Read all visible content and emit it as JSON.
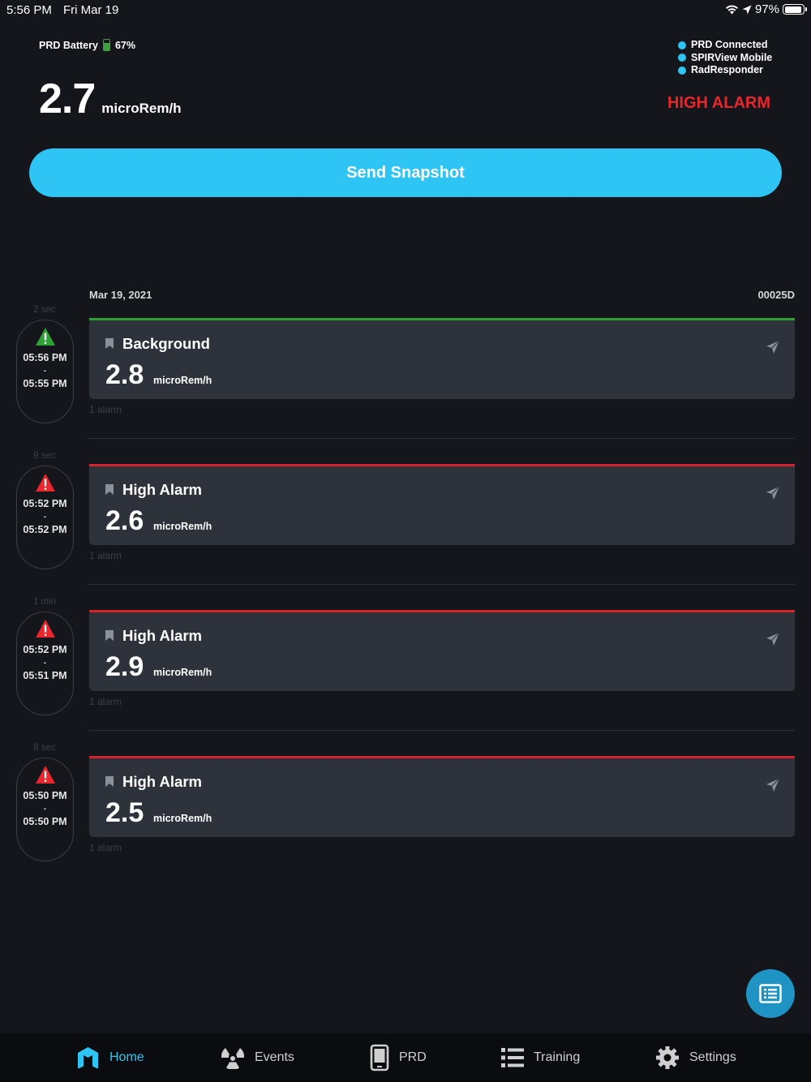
{
  "status_bar": {
    "time": "5:56 PM",
    "date": "Fri Mar 19",
    "battery": "97%"
  },
  "header": {
    "prd_battery_label": "PRD Battery",
    "prd_battery_value": "67%",
    "reading_value": "2.7",
    "reading_unit": "microRem/h",
    "connections": [
      "PRD Connected",
      "SPIRView Mobile",
      "RadResponder"
    ],
    "alarm_status": "HIGH ALARM"
  },
  "snapshot_button": "Send Snapshot",
  "list": {
    "date": "Mar 19, 2021",
    "device_id": "00025D",
    "events": [
      {
        "duration": "2 sec",
        "severity": "green",
        "start": "05:56 PM",
        "dash": "-",
        "end": "05:55 PM",
        "title": "Background",
        "value": "2.8",
        "unit": "microRem/h",
        "alarm_count": "1 alarm"
      },
      {
        "duration": "9 sec",
        "severity": "red",
        "start": "05:52 PM",
        "dash": "-",
        "end": "05:52 PM",
        "title": "High Alarm",
        "value": "2.6",
        "unit": "microRem/h",
        "alarm_count": "1 alarm"
      },
      {
        "duration": "1 min",
        "severity": "red",
        "start": "05:52 PM",
        "dash": "-",
        "end": "05:51 PM",
        "title": "High Alarm",
        "value": "2.9",
        "unit": "microRem/h",
        "alarm_count": "1 alarm"
      },
      {
        "duration": "8 sec",
        "severity": "red",
        "start": "05:50 PM",
        "dash": "-",
        "end": "05:50 PM",
        "title": "High Alarm",
        "value": "2.5",
        "unit": "microRem/h",
        "alarm_count": "1 alarm"
      }
    ]
  },
  "tabs": [
    {
      "label": "Home",
      "icon": "home-icon",
      "active": true
    },
    {
      "label": "Events",
      "icon": "radiation-icon",
      "active": false
    },
    {
      "label": "PRD",
      "icon": "device-icon",
      "active": false
    },
    {
      "label": "Training",
      "icon": "list-icon",
      "active": false
    },
    {
      "label": "Settings",
      "icon": "gear-icon",
      "active": false
    }
  ],
  "colors": {
    "accent": "#2ec4f4",
    "alarm": "#e8262b",
    "ok": "#2fa236",
    "background": "#14161b",
    "card": "#2d323b"
  }
}
